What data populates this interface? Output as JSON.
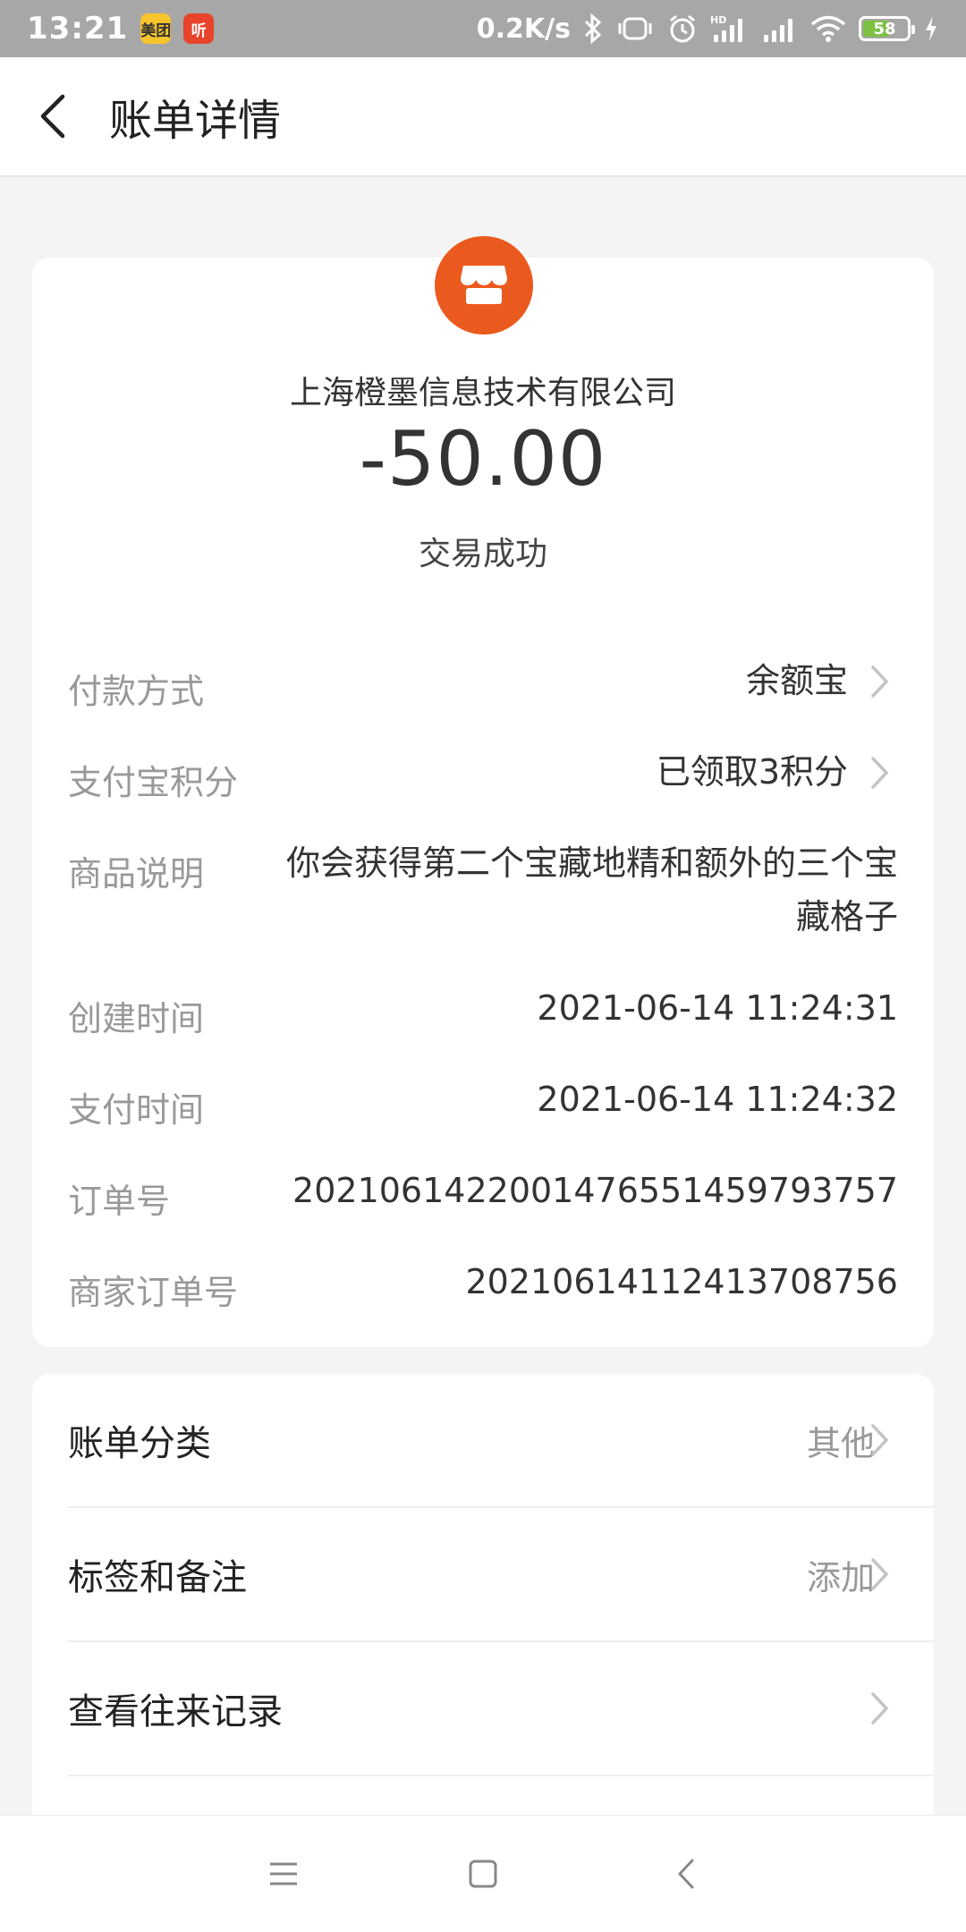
{
  "status_bar": {
    "time": "13:21",
    "app1": "美团",
    "app2": "听",
    "net_speed": "0.2K/s",
    "battery": "58"
  },
  "header": {
    "title": "账单详情"
  },
  "transaction": {
    "merchant": "上海橙墨信息技术有限公司",
    "amount": "-50.00",
    "status": "交易成功",
    "logo_color": "#ea5a1f"
  },
  "details": [
    {
      "label": "付款方式",
      "value": "余额宝"
    },
    {
      "label": "支付宝积分",
      "value": "已领取3积分"
    },
    {
      "label": "商品说明",
      "value": "你会获得第二个宝藏地精和额外的三个宝藏格子"
    },
    {
      "label": "创建时间",
      "value": "2021-06-14 11:24:31"
    },
    {
      "label": "支付时间",
      "value": "2021-06-14 11:24:32"
    },
    {
      "label": "订单号",
      "value": "2021061422001476551459793757"
    },
    {
      "label": "商家订单号",
      "value": "20210614112413708756"
    }
  ],
  "actions": [
    {
      "label": "账单分类",
      "value": "其他"
    },
    {
      "label": "标签和备注",
      "value": "添加"
    },
    {
      "label": "查看往来记录",
      "value": ""
    }
  ],
  "nav_icons": [
    "menu-icon",
    "home-icon",
    "back-icon"
  ]
}
